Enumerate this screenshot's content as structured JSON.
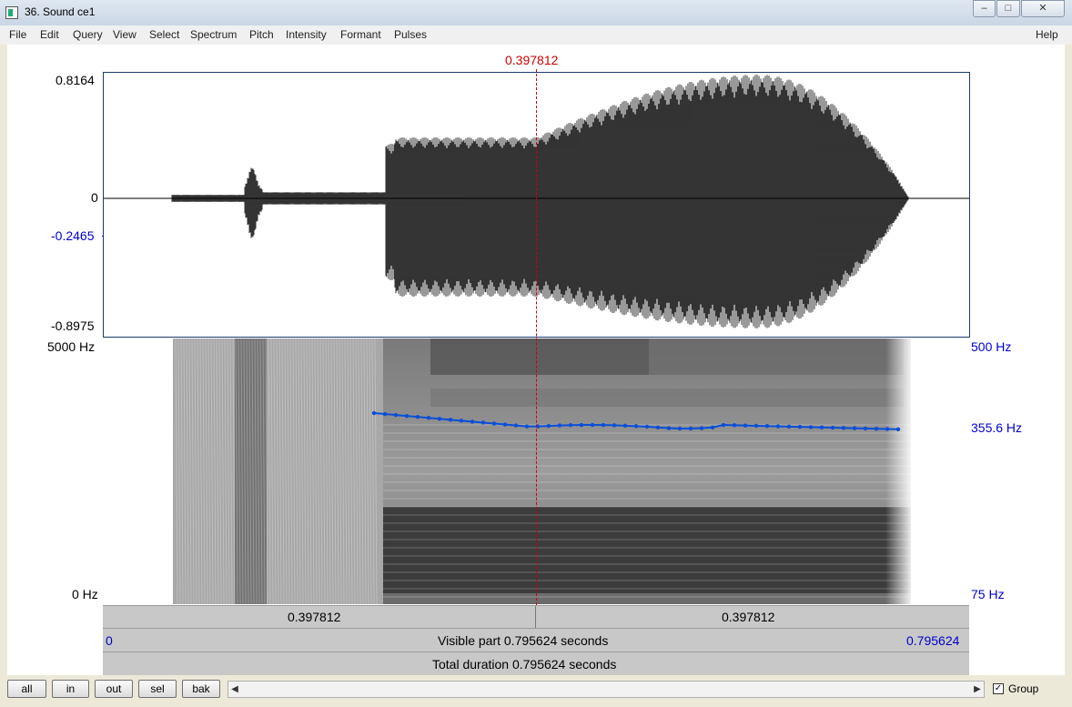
{
  "window": {
    "title": "36. Sound ce1"
  },
  "menu": [
    "File",
    "Edit",
    "Query",
    "View",
    "Select",
    "Spectrum",
    "Pitch",
    "Intensity",
    "Formant",
    "Pulses"
  ],
  "help_label": "Help",
  "cursor": {
    "time_label": "0.397812"
  },
  "waveform": {
    "max_label": "0.8164",
    "zero_label": "0",
    "cursor_value_label": "-0.2465",
    "min_label": "-0.8975"
  },
  "spectrogram": {
    "freq_max_label": "5000 Hz",
    "freq_min_label": "0 Hz"
  },
  "pitch": {
    "max_label": "500 Hz",
    "cursor_value_label": "355.6 Hz",
    "min_label": "75 Hz"
  },
  "time_segments": {
    "left": "0.397812",
    "right": "0.397812"
  },
  "visible_part": {
    "start": "0",
    "label": "Visible part 0.795624 seconds",
    "end": "0.795624"
  },
  "total_duration": {
    "label": "Total duration 0.795624 seconds"
  },
  "buttons": {
    "all": "all",
    "in": "in",
    "out": "out",
    "sel": "sel",
    "bak": "bak"
  },
  "group_checkbox": {
    "label": "Group",
    "checked": true
  },
  "colors": {
    "axis_blue": "#0000cc",
    "cursor_red": "#cc0000",
    "pitch_line": "#0a4fd8"
  }
}
